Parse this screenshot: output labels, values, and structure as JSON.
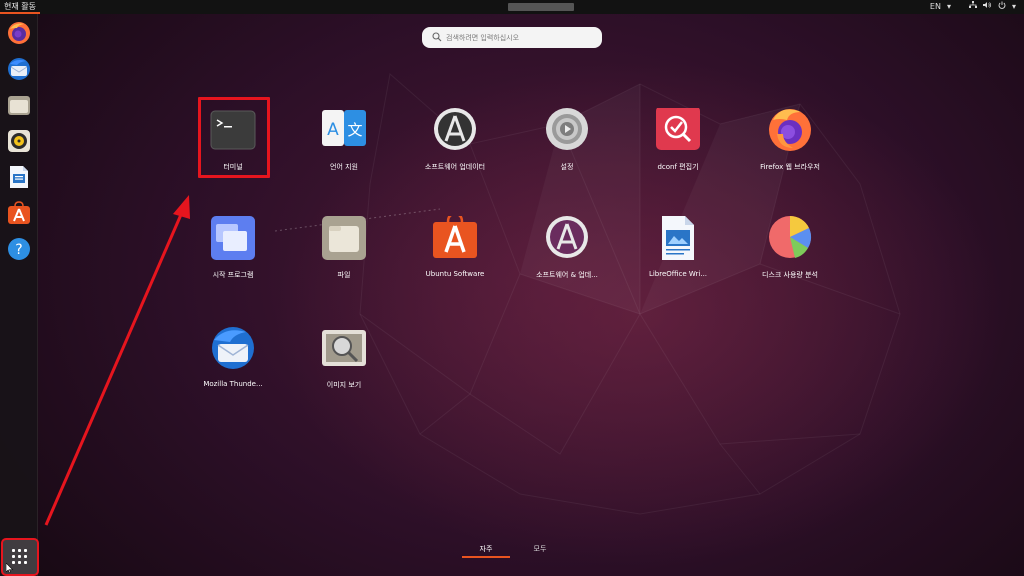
{
  "topbar": {
    "activities": "현재 활동",
    "lang": "EN",
    "icons": [
      "network-icon",
      "volume-icon",
      "power-icon",
      "chevron-down-icon"
    ]
  },
  "dock": {
    "items": [
      "firefox-icon",
      "thunderbird-icon",
      "files-icon",
      "rhythmbox-icon",
      "writer-icon",
      "software-icon",
      "help-icon"
    ],
    "show_apps": "apps-grid-icon"
  },
  "search": {
    "placeholder": "검색하려면 입력하십시오"
  },
  "apps": [
    {
      "label": "터미널",
      "icon": "terminal-icon"
    },
    {
      "label": "언어 지원",
      "icon": "language-icon"
    },
    {
      "label": "소프트웨어 업데이터",
      "icon": "software-updater-icon"
    },
    {
      "label": "설정",
      "icon": "settings-icon"
    },
    {
      "label": "dconf 편집기",
      "icon": "dconf-editor-icon"
    },
    {
      "label": "Firefox 웹 브라우저",
      "icon": "firefox-icon"
    },
    {
      "label": "시작 프로그램",
      "icon": "startup-apps-icon"
    },
    {
      "label": "파일",
      "icon": "files-icon"
    },
    {
      "label": "Ubuntu Software",
      "icon": "ubuntu-software-icon"
    },
    {
      "label": "소프트웨어 & 업데...",
      "icon": "software-properties-icon"
    },
    {
      "label": "LibreOffice Wri...",
      "icon": "writer-icon"
    },
    {
      "label": "디스크 사용량 분석",
      "icon": "disk-usage-icon"
    },
    {
      "label": "Mozilla Thunde...",
      "icon": "thunderbird-icon"
    },
    {
      "label": "이미지 보기",
      "icon": "image-viewer-icon"
    }
  ],
  "tabs": {
    "frequent": "자주",
    "all": "모두"
  },
  "colors": {
    "accent": "#e95420",
    "annotation": "#e6151e"
  }
}
